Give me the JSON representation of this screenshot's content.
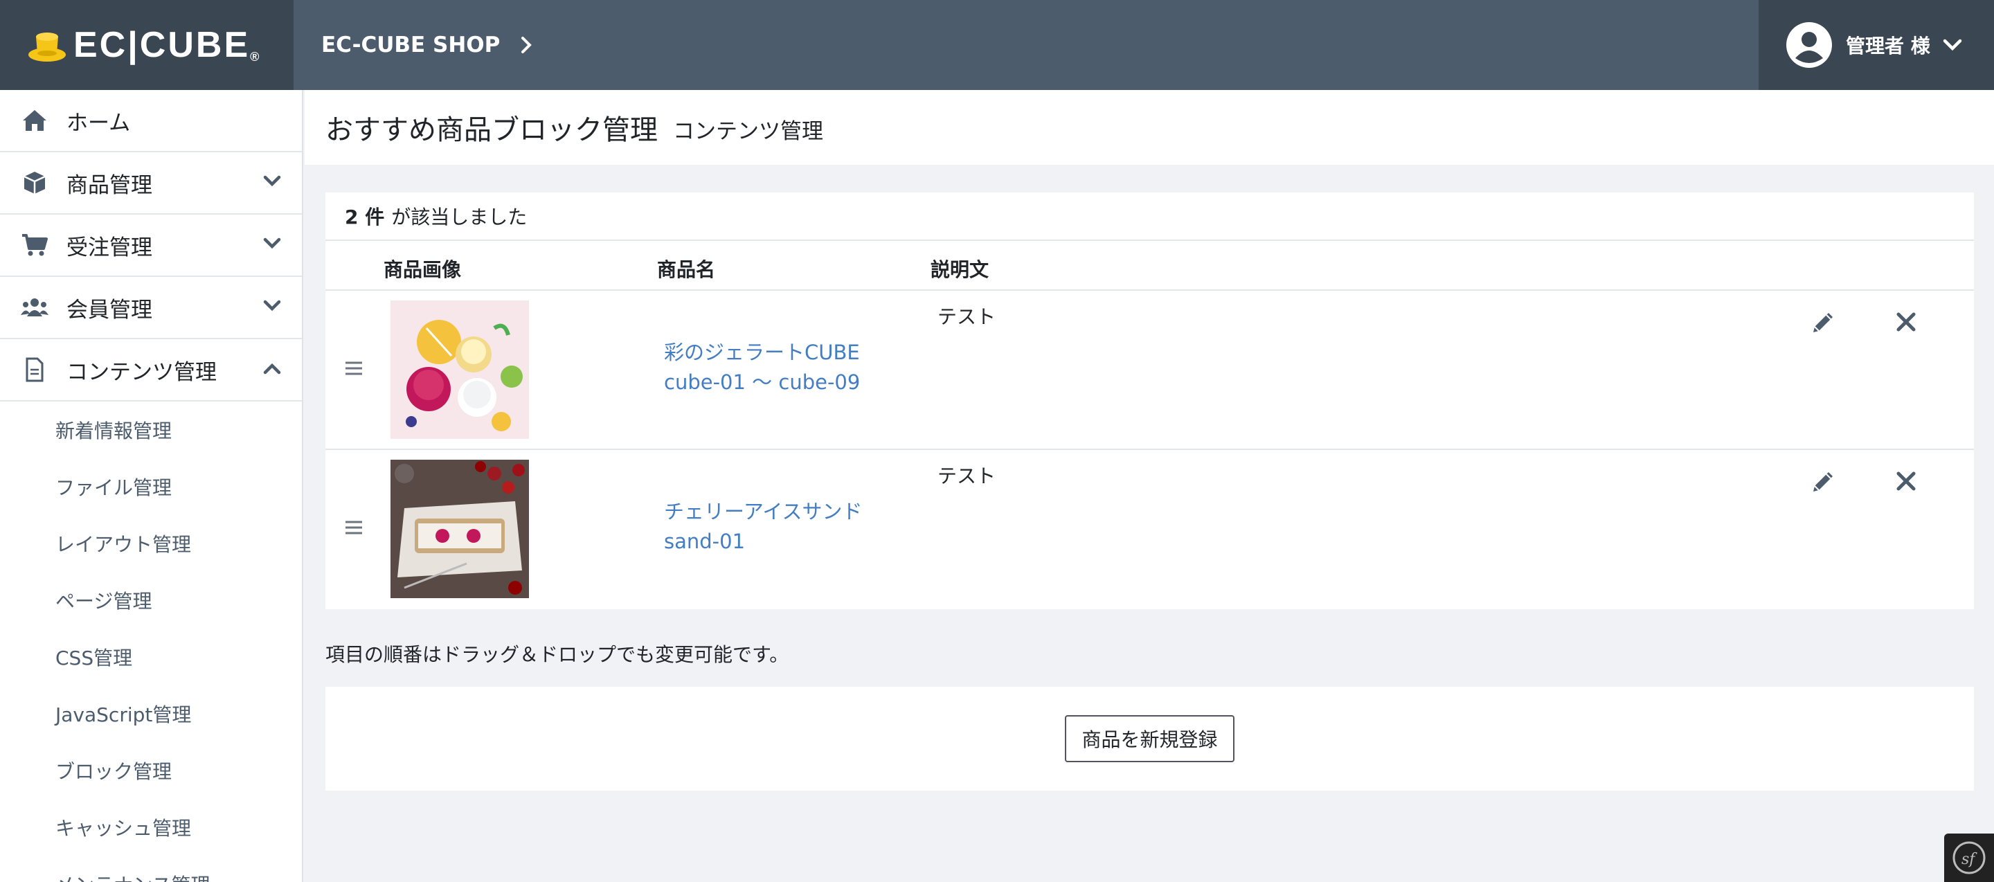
{
  "header": {
    "logo_text": "EC|CUBE",
    "logo_mark": "®",
    "shop_name": "EC-CUBE SHOP",
    "user_name": "管理者 様"
  },
  "sidebar": {
    "items": [
      {
        "label": "ホーム",
        "icon": "home-icon"
      },
      {
        "label": "商品管理",
        "icon": "box-icon"
      },
      {
        "label": "受注管理",
        "icon": "cart-icon"
      },
      {
        "label": "会員管理",
        "icon": "users-icon"
      },
      {
        "label": "コンテンツ管理",
        "icon": "file-icon"
      }
    ],
    "subitems": [
      "新着情報管理",
      "ファイル管理",
      "レイアウト管理",
      "ページ管理",
      "CSS管理",
      "JavaScript管理",
      "ブロック管理",
      "キャッシュ管理",
      "メンテナンス管理"
    ]
  },
  "page": {
    "title": "おすすめ商品ブロック管理",
    "subtitle": "コンテンツ管理"
  },
  "results": {
    "count": "2 件",
    "count_suffix": "が該当しました"
  },
  "table": {
    "columns": [
      "商品画像",
      "商品名",
      "説明文"
    ],
    "rows": [
      {
        "name": "彩のジェラートCUBE",
        "code": "cube-01 〜 cube-09",
        "description": "テスト"
      },
      {
        "name": "チェリーアイスサンド",
        "code": "sand-01",
        "description": "テスト"
      }
    ]
  },
  "hint": "項目の順番はドラッグ＆ドロップでも変更可能です。",
  "register_button": "商品を新規登録",
  "colors": {
    "header": "#4c5c6c",
    "header_dark": "#3a4652",
    "link": "#437ec4",
    "accent_logo": "#f5c518"
  }
}
